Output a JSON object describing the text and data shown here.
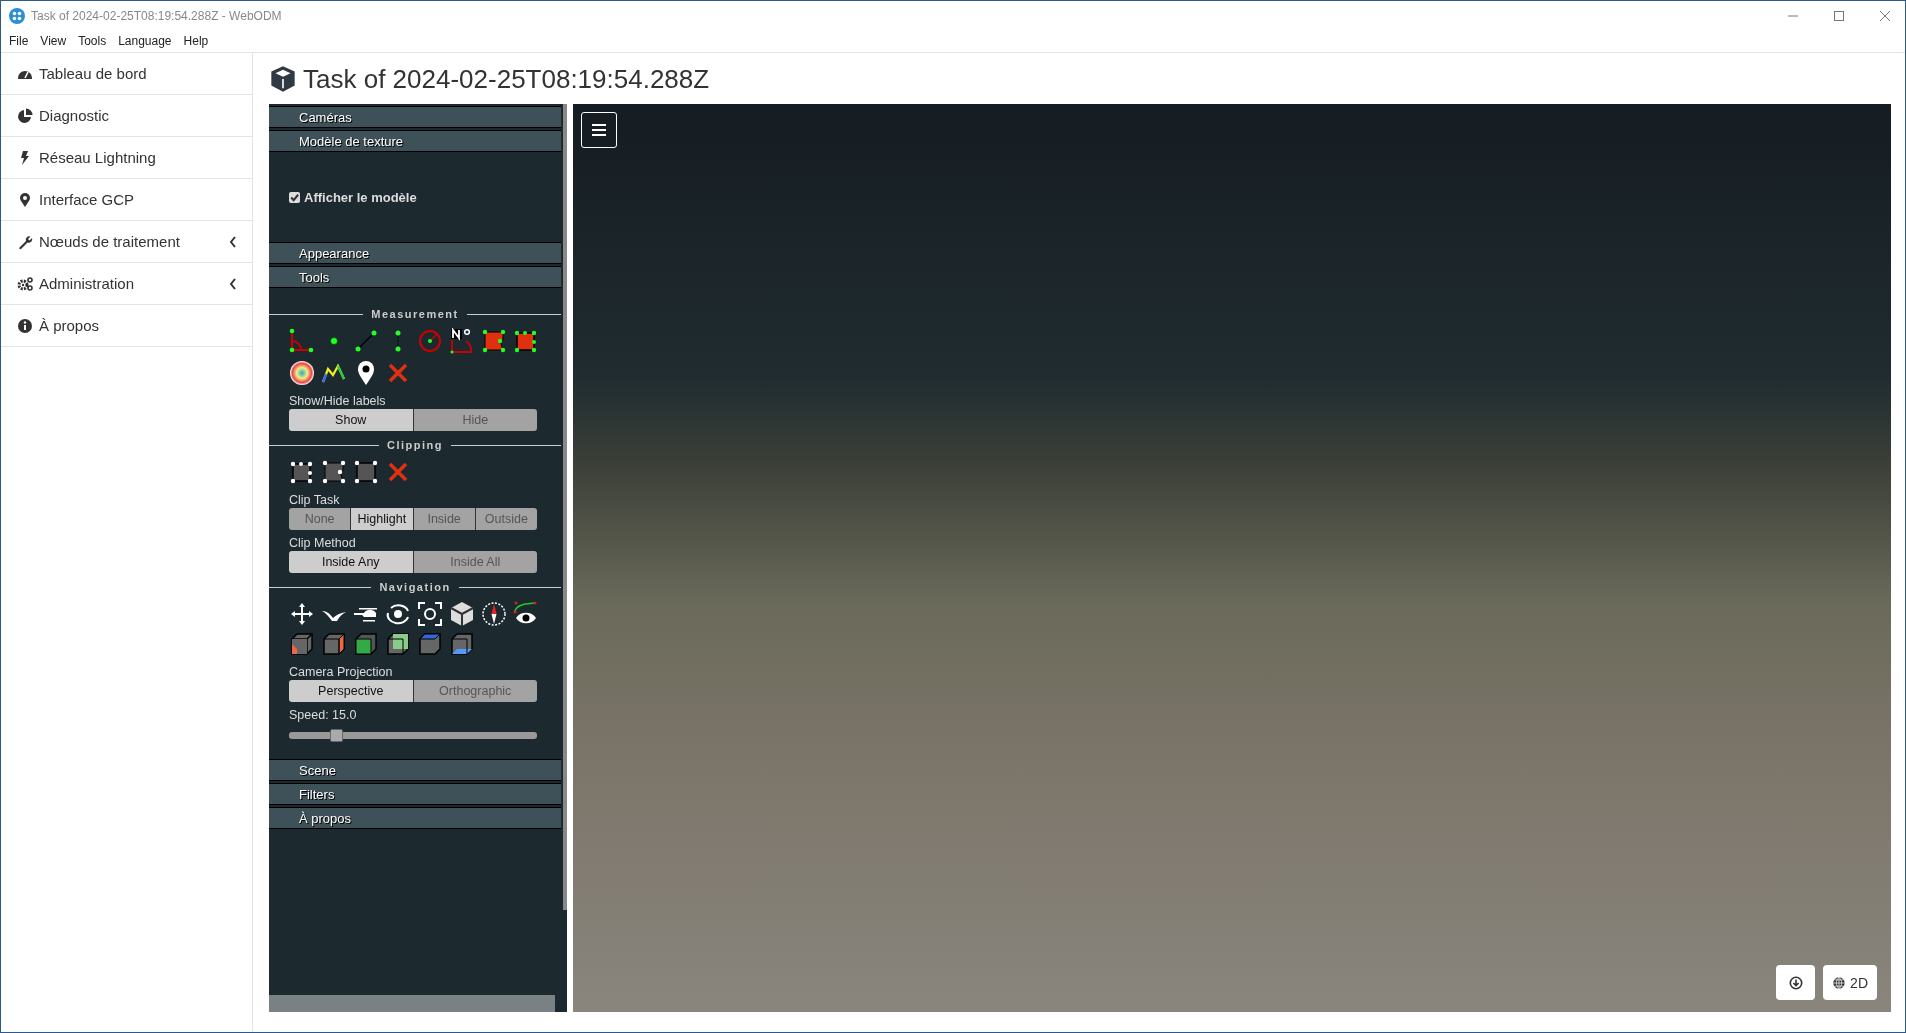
{
  "window": {
    "title": "Task of 2024-02-25T08:19:54.288Z - WebODM"
  },
  "menu": [
    "File",
    "View",
    "Tools",
    "Language",
    "Help"
  ],
  "sidebar": {
    "items": [
      {
        "label": "Tableau de bord",
        "has_submenu": false
      },
      {
        "label": "Diagnostic",
        "has_submenu": false
      },
      {
        "label": "Réseau Lightning",
        "has_submenu": false
      },
      {
        "label": "Interface GCP",
        "has_submenu": false
      },
      {
        "label": "Nœuds de traitement",
        "has_submenu": true
      },
      {
        "label": "Administration",
        "has_submenu": true
      },
      {
        "label": "À propos",
        "has_submenu": false
      }
    ]
  },
  "page_title": "Task of 2024-02-25T08:19:54.288Z",
  "panel": {
    "top_sections": [
      "Caméras",
      "Modèle de texture"
    ],
    "texture": {
      "checkbox": {
        "label": "Afficher le modèle",
        "checked": true
      }
    },
    "middle_sections": [
      "Appearance",
      "Tools"
    ],
    "measurement": {
      "title": "Measurement",
      "labels_title": "Show/Hide labels",
      "labels_toggle": [
        {
          "label": "Show",
          "selected": true
        },
        {
          "label": "Hide",
          "selected": false
        }
      ]
    },
    "clipping": {
      "title": "Clipping",
      "clip_task_label": "Clip Task",
      "clip_task": [
        {
          "label": "None",
          "selected": false
        },
        {
          "label": "Highlight",
          "selected": true
        },
        {
          "label": "Inside",
          "selected": false
        },
        {
          "label": "Outside",
          "selected": false
        }
      ],
      "clip_method_label": "Clip Method",
      "clip_method": [
        {
          "label": "Inside Any",
          "selected": true
        },
        {
          "label": "Inside All",
          "selected": false
        }
      ]
    },
    "navigation": {
      "title": "Navigation",
      "projection_label": "Camera Projection",
      "projection": [
        {
          "label": "Perspective",
          "selected": true
        },
        {
          "label": "Orthographic",
          "selected": false
        }
      ],
      "speed_label": "Speed: 15.0",
      "speed": {
        "level": 0.19
      }
    },
    "bottom_sections": [
      "Scene",
      "Filters",
      "À propos"
    ]
  },
  "viewer": {
    "mode_button": {
      "label": "2D"
    }
  }
}
